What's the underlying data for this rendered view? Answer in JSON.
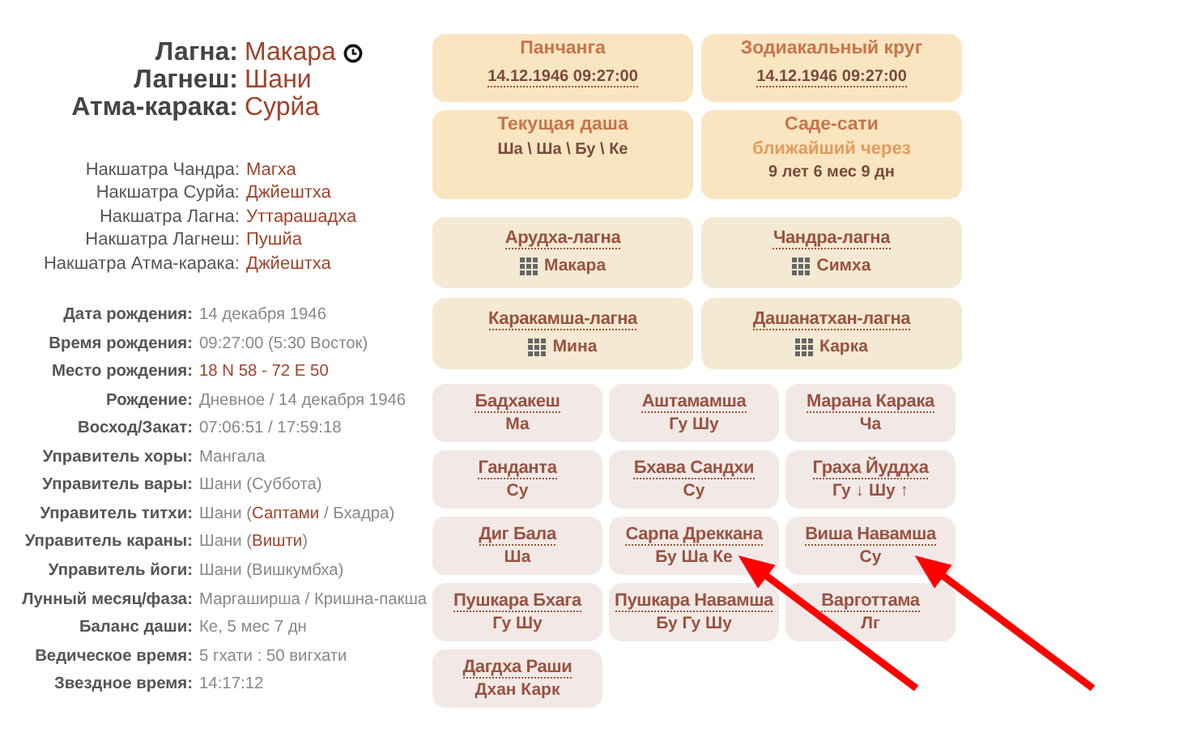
{
  "main": [
    {
      "label": "Лагна:",
      "value": "Макара",
      "timer": true
    },
    {
      "label": "Лагнеш:",
      "value": "Шани",
      "timer": false
    },
    {
      "label": "Атма-карака:",
      "value": "Сурйа",
      "timer": false
    }
  ],
  "nakshatras": [
    {
      "label": "Накшатра Чандра:",
      "value": "Магха"
    },
    {
      "label": "Накшатра Сурйа:",
      "value": "Джйештха"
    },
    {
      "label": "Накшатра Лагна:",
      "value": "Уттарашадха"
    },
    {
      "label": "Накшатра Лагнеш:",
      "value": "Пушйа"
    },
    {
      "label": "Накшатра Атма-карака:",
      "value": "Джйештха"
    }
  ],
  "details": [
    {
      "label": "Дата рождения:",
      "value": [
        {
          "text": "14 декабря 1946",
          "accent": false
        }
      ]
    },
    {
      "label": "Время рождения:",
      "value": [
        {
          "text": "09:27:00 (5:30 Восток)",
          "accent": false
        }
      ]
    },
    {
      "label": "Место рождения:",
      "value": [
        {
          "text": "18 N 58 - 72 E 50",
          "accent": true
        }
      ]
    },
    {
      "label": "Рождение:",
      "value": [
        {
          "text": "Дневное / 14 декабря 1946",
          "accent": false
        }
      ]
    },
    {
      "label": "Восход/Закат:",
      "value": [
        {
          "text": "07:06:51 / 17:59:18",
          "accent": false
        }
      ]
    },
    {
      "label": "Управитель хоры:",
      "value": [
        {
          "text": "Мангала",
          "accent": false
        }
      ]
    },
    {
      "label": "Управитель вары:",
      "value": [
        {
          "text": "Шани (Суббота)",
          "accent": false
        }
      ]
    },
    {
      "label": "Управитель титхи:",
      "value": [
        {
          "text": "Шани (",
          "accent": false
        },
        {
          "text": "Саптами",
          "accent": true
        },
        {
          "text": " / Бхадра)",
          "accent": false
        }
      ]
    },
    {
      "label": "Управитель караны:",
      "value": [
        {
          "text": "Шани (",
          "accent": false
        },
        {
          "text": "Вишти",
          "accent": true
        },
        {
          "text": ")",
          "accent": false
        }
      ]
    },
    {
      "label": "Управитель йоги:",
      "value": [
        {
          "text": "Шани (Вишкумбха)",
          "accent": false
        }
      ]
    },
    {
      "label": "Лунный месяц/фаза:",
      "value": [
        {
          "text": "Маргаширша / Кришна-пакша",
          "accent": false
        }
      ]
    },
    {
      "label": "Баланс даши:",
      "value": [
        {
          "text": "Ке, 5 мес 7 дн",
          "accent": false
        }
      ]
    },
    {
      "label": "Ведическое время:",
      "value": [
        {
          "text": "5 гхати : 50 вигхати",
          "accent": false
        }
      ]
    },
    {
      "label": "Звездное время:",
      "value": [
        {
          "text": "14:17:12",
          "accent": false
        }
      ]
    }
  ],
  "summary_tiles": [
    {
      "title": "Панчанга",
      "lines": [
        {
          "text": "14.12.1946 09:27:00",
          "kind": "link"
        }
      ]
    },
    {
      "title": "Зодиакальный круг",
      "lines": [
        {
          "text": "14.12.1946 09:27:00",
          "kind": "link"
        }
      ]
    },
    {
      "title": "Текущая даша",
      "lines": [
        {
          "text": "Ша \\ Ша \\ Бу \\ Ке",
          "kind": "plain"
        }
      ]
    },
    {
      "title": "Саде-сати",
      "lines": [
        {
          "text": "ближайший через",
          "kind": "accent"
        },
        {
          "text": "9 лет 6 мес 9 дн",
          "kind": "plain"
        }
      ]
    }
  ],
  "lagna_tiles": [
    {
      "title": "Арудха-лагна",
      "sign": "Макара"
    },
    {
      "title": "Чандра-лагна",
      "sign": "Симха"
    },
    {
      "title": "Каракамша-лагна",
      "sign": "Мина"
    },
    {
      "title": "Дашанатхан-лагна",
      "sign": "Карка"
    }
  ],
  "factor_tiles": [
    {
      "title": "Бадхакеш",
      "value": "Ма",
      "arrowed": false
    },
    {
      "title": "Аштамамша",
      "value": "Гу Шу",
      "arrowed": false
    },
    {
      "title": "Марана Карака",
      "value": "Ча",
      "arrowed": false
    },
    {
      "title": "Ганданта",
      "value": "Су",
      "arrowed": false
    },
    {
      "title": "Бхава Сандхи",
      "value": "Су",
      "arrowed": false
    },
    {
      "title": "Граха Йуддха",
      "value": "Гу ↓ Шу ↑",
      "arrowed": false
    },
    {
      "title": "Диг Бала",
      "value": "Ша",
      "arrowed": false
    },
    {
      "title": "Сарпа Дреккана",
      "value": "Бу Ша Ке",
      "arrowed": true
    },
    {
      "title": "Виша Навамша",
      "value": "Су",
      "arrowed": true
    },
    {
      "title": "Пушкара Бхага",
      "value": "Гу Шу",
      "arrowed": false
    },
    {
      "title": "Пушкара Навамша",
      "value": "Бу Гу Шу",
      "arrowed": false
    },
    {
      "title": "Варготтама",
      "value": "Лг",
      "arrowed": false
    },
    {
      "title": "Дагдха Раши",
      "value": "Дхан Карк",
      "arrowed": false
    }
  ]
}
